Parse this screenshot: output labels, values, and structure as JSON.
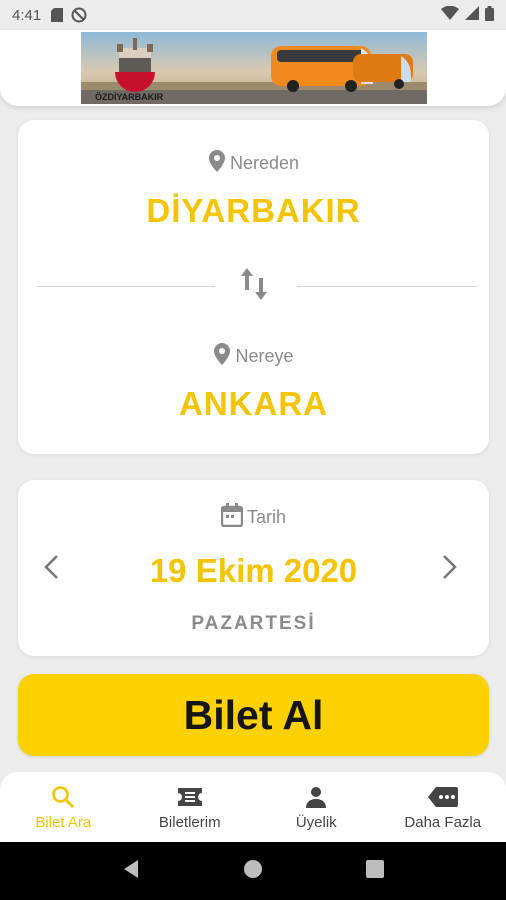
{
  "status_bar": {
    "time": "4:41"
  },
  "banner": {
    "brand": "ÖZDİYARBAKIR"
  },
  "route": {
    "from_label": "Nereden",
    "from_city": "DİYARBAKIR",
    "to_label": "Nereye",
    "to_city": "ANKARA"
  },
  "date": {
    "label": "Tarih",
    "value": "19 Ekim 2020",
    "weekday": "PAZARTESİ"
  },
  "buy_button": {
    "label": "Bilet Al"
  },
  "bottom_nav": {
    "items": [
      {
        "label": "Bilet Ara",
        "icon": "search-icon",
        "active": true
      },
      {
        "label": "Biletlerim",
        "icon": "ticket-icon",
        "active": false
      },
      {
        "label": "Üyelik",
        "icon": "person-icon",
        "active": false
      },
      {
        "label": "Daha Fazla",
        "icon": "more-icon",
        "active": false
      }
    ]
  },
  "colors": {
    "accent": "#f5c400",
    "button": "#fcd100",
    "muted": "#8a8a8a"
  }
}
